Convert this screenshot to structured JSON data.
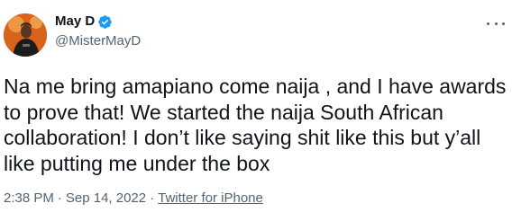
{
  "author": {
    "display_name": "May D",
    "handle": "@MisterMayD",
    "verified": true
  },
  "tweet": {
    "text": "Na me bring amapiano come naija , and I have awards\nto prove that! We started the naija South African\ncollaboration! I don’t like saying shit like this but y’all\nlike putting me under the box"
  },
  "meta": {
    "time": "2:38 PM",
    "date": "Sep 14, 2022",
    "separator": "·",
    "source": "Twitter for iPhone"
  },
  "icons": {
    "verified": "verified-badge-icon",
    "more": "more-options-icon"
  },
  "colors": {
    "text": "#0f1419",
    "secondary": "#536471",
    "verified_blue": "#1d9bf0"
  }
}
